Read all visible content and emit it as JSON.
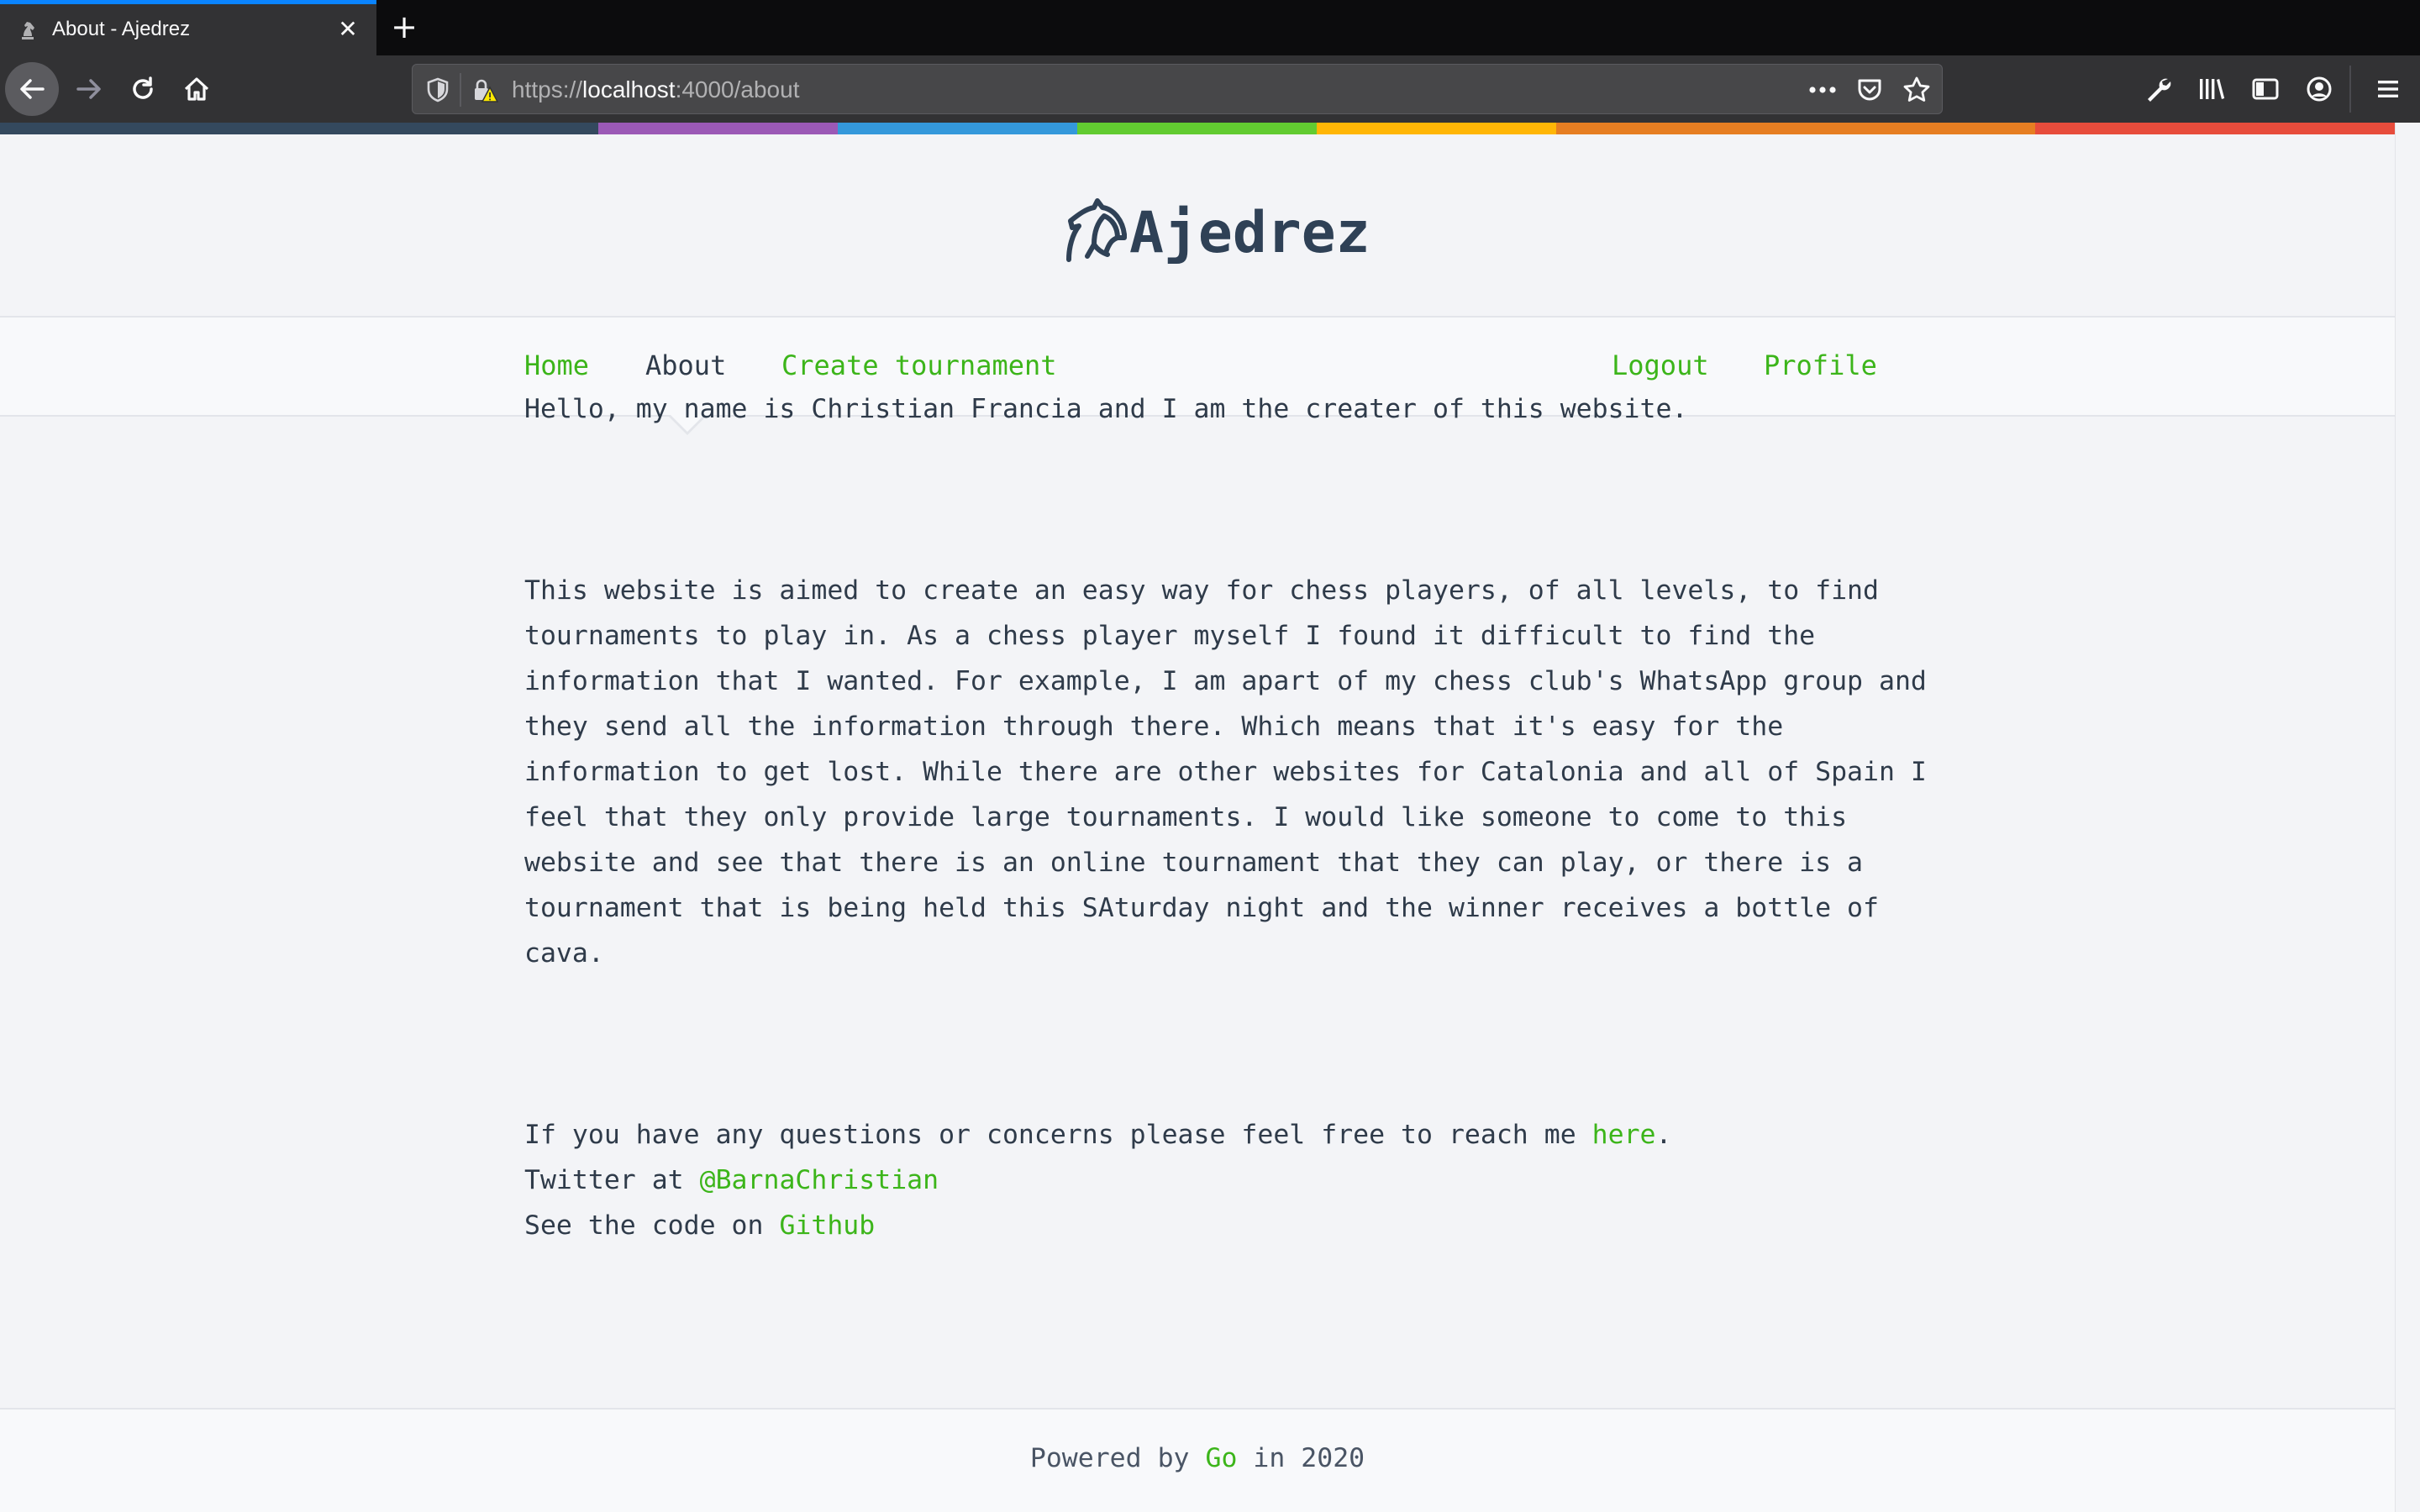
{
  "browser": {
    "tab": {
      "title": "About - Ajedrez",
      "close_glyph": "✕"
    },
    "new_tab_glyph": "+",
    "url": {
      "scheme": "https://",
      "host": "localhost",
      "rest": ":4000/about"
    },
    "icons": {
      "back": "back-arrow-icon",
      "forward": "forward-arrow-icon",
      "reload": "reload-icon",
      "home": "home-icon",
      "shield": "tracking-shield-icon",
      "lock": "insecure-lock-icon",
      "more": "more-actions-icon",
      "pocket": "pocket-icon",
      "bookmark": "bookmark-star-icon",
      "wrench": "developer-wrench-icon",
      "library": "library-icon",
      "sidebar": "sidebar-icon",
      "account": "account-icon",
      "menu": "hamburger-menu-icon"
    },
    "chrome_colors": {
      "tab_accent": "#0a84ff",
      "chrome_bg": "#323234",
      "tabstrip_bg": "#0c0c0d"
    }
  },
  "site": {
    "brand": "Ajedrez",
    "rainbow_colors": [
      "#34495e",
      "#9b59b6",
      "#3498db",
      "#62cb31",
      "#ffb606",
      "#e67e22",
      "#e74c3c"
    ],
    "accent_color": "#3cb51a",
    "nav": {
      "home": "Home",
      "about": "About",
      "create": "Create tournament",
      "logout": "Logout",
      "profile": "Profile"
    },
    "content": {
      "intro": "Hello, my name is Christian Francia and I am the creater of this website.",
      "body_lines": [
        "This website is aimed to create an easy way for chess players, of all levels, to find",
        "tournaments to play in. As a chess player myself I found it difficult to find the",
        "information that I wanted. For example, I am apart of my chess club's WhatsApp group and",
        "they send all the information through there. Which means that it's easy for the",
        "information to get lost. While there are other websites for Catalonia and all of Spain I",
        "feel that they only provide large tournaments. I would like someone to come to this",
        "website and see that there is an online tournament that they can play, or there is a",
        "tournament that is being held this SAturday night and the winner receives a bottle of",
        "cava."
      ],
      "contact_prefix": "If you have any questions or concerns please feel free to reach me ",
      "contact_link": "here",
      "contact_suffix": ".",
      "twitter_prefix": "Twitter at ",
      "twitter_link": "@BarnaChristian",
      "github_prefix": "See the code on ",
      "github_link": "Github"
    },
    "footer": {
      "prefix": "Powered by ",
      "link": "Go",
      "suffix": " in 2020"
    }
  }
}
